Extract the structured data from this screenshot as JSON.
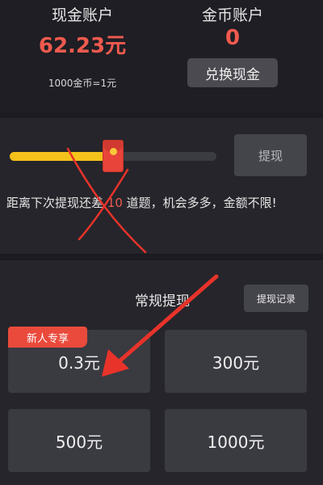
{
  "accounts": {
    "cash_title": "现金账户",
    "cash_value": "62.23元",
    "coin_title": "金币账户",
    "coin_value": "0",
    "exchange_rate": "1000金币=1元",
    "exchange_button": "兑换现金"
  },
  "progress": {
    "fraction": 0.5,
    "withdraw_button": "提现",
    "hint_before": "距离下次提现还差 ",
    "hint_count": "10",
    "hint_after": " 道题，机会多多，金额不限!"
  },
  "regular": {
    "title": "常规提现",
    "records_button": "提现记录",
    "badge": "新人专享",
    "options": [
      "0.3元",
      "300元",
      "500元",
      "1000元"
    ]
  },
  "colors": {
    "accent_red": "#ef5a4e",
    "progress_yellow": "#f4c21b",
    "annotation_red": "#e8332a"
  }
}
